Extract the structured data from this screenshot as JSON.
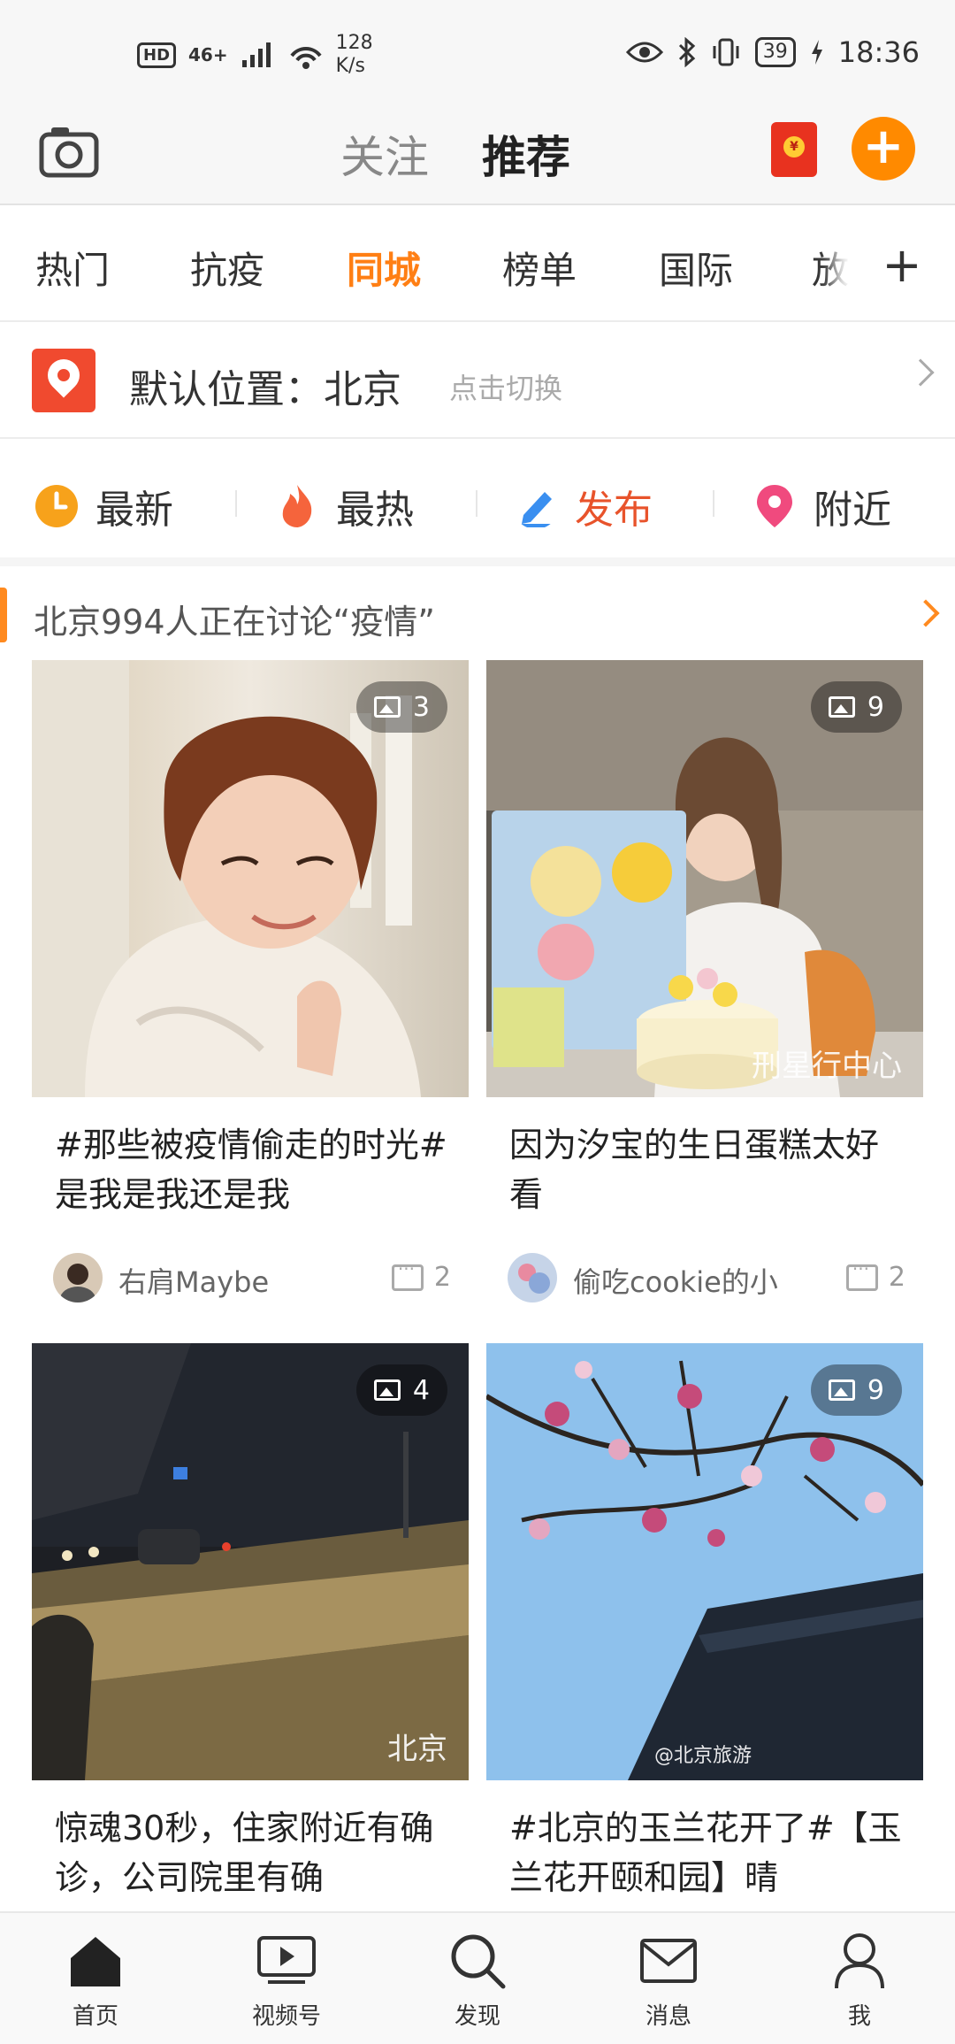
{
  "status_bar": {
    "hd": "HD",
    "network": "46+",
    "speed_value": "128",
    "speed_unit": "K/s",
    "battery": "39",
    "time": "18:36"
  },
  "header": {
    "tabs": [
      {
        "label": "关注",
        "active": false
      },
      {
        "label": "推荐",
        "active": true
      }
    ],
    "icons": [
      "camera-icon",
      "red-packet-icon",
      "plus-icon"
    ],
    "accent_color": "#ff8a00"
  },
  "channels": {
    "items": [
      {
        "label": "热门",
        "active": false
      },
      {
        "label": "抗疫",
        "active": false
      },
      {
        "label": "同城",
        "active": true
      },
      {
        "label": "榜单",
        "active": false
      },
      {
        "label": "国际",
        "active": false
      },
      {
        "label": "放",
        "active": false
      }
    ],
    "add_label": "+"
  },
  "location": {
    "label": "默认位置：北京",
    "hint": "点击切换"
  },
  "filters": [
    {
      "label": "最新",
      "icon": "clock-icon",
      "color": "#f7a21b"
    },
    {
      "label": "最热",
      "icon": "flame-icon",
      "color": "#f5643c"
    },
    {
      "label": "发布",
      "icon": "pen-icon",
      "color": "#3a8ff0"
    },
    {
      "label": "附近",
      "icon": "location-pin-icon",
      "color": "#f04a7e"
    }
  ],
  "hot_topic": {
    "text": "北京994人正在讨论“疫情”"
  },
  "cards": [
    {
      "image_count": "3",
      "title": "#那些被疫情偷走的时光#是我是我还是我",
      "author": "右肩Maybe",
      "comments": "2",
      "watermark": ""
    },
    {
      "image_count": "9",
      "title": "因为汐宝的生日蛋糕太好看",
      "author": "偷吃cookie的小",
      "comments": "2",
      "watermark": "刑星行中心"
    },
    {
      "image_count": "4",
      "title": "惊魂30秒，住家附近有确诊，公司院里有确",
      "author": "",
      "comments": "",
      "watermark": "北京"
    },
    {
      "image_count": "9",
      "title": "#北京的玉兰花开了#【玉兰花开颐和园】晴",
      "author": "",
      "comments": "",
      "watermark": "@北京旅游"
    }
  ],
  "bottom_nav": [
    {
      "label": "首页",
      "icon": "home-icon"
    },
    {
      "label": "视频号",
      "icon": "video-icon"
    },
    {
      "label": "发现",
      "icon": "search-icon"
    },
    {
      "label": "消息",
      "icon": "mail-icon"
    },
    {
      "label": "我",
      "icon": "profile-icon"
    }
  ]
}
